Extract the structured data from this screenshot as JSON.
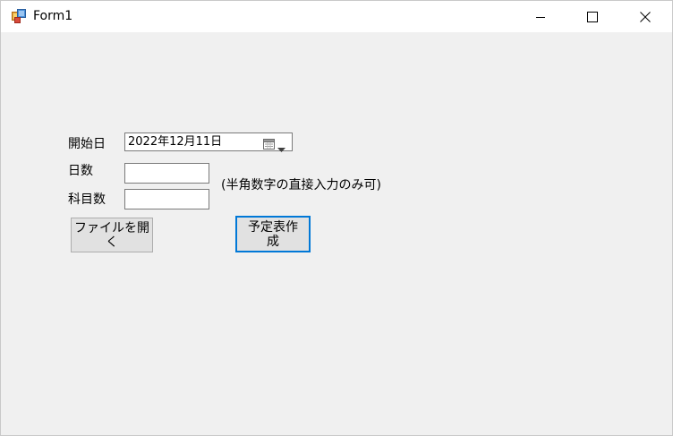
{
  "window": {
    "title": "Form1"
  },
  "form": {
    "start_date_label": "開始日",
    "start_date_value": "2022年12月11日",
    "days_label": "日数",
    "days_value": "",
    "subjects_label": "科目数",
    "subjects_value": "",
    "hint_text": "(半角数字の直接入力のみ可)",
    "open_file_button": "ファイルを開く",
    "create_schedule_button": "予定表作成"
  },
  "icons": {
    "app": "windows-form-icon",
    "minimize": "minimize-icon",
    "maximize": "maximize-icon",
    "close": "close-icon",
    "calendar": "calendar-icon",
    "dropdown": "chevron-down-icon"
  },
  "colors": {
    "client_background": "#f0f0f0",
    "titlebar_background": "#ffffff",
    "button_face": "#e1e1e1",
    "default_button_border": "#0078d7"
  }
}
